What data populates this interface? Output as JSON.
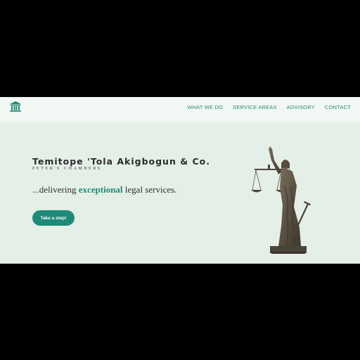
{
  "navbar": {
    "logo_icon": "courthouse-icon",
    "links": [
      "WHAT WE DO",
      "SERVICE AREAS",
      "ADVISORY",
      "CONTACT"
    ]
  },
  "hero": {
    "title": "Temitope 'Tola Akigbogun & Co.",
    "subtitle": "PETER'S CHAMBERS",
    "tagline_prefix": "...delivering ",
    "tagline_accent": "exceptional",
    "tagline_suffix": " legal services.",
    "cta_label": "Take a step!",
    "image_icon": "lady-justice-statue"
  },
  "colors": {
    "accent": "#1e8a78",
    "nav_text": "#2a8a78",
    "hero_bg": "#e4efe8",
    "nav_bg": "#f1f7f2",
    "outer_bg": "#000000"
  }
}
